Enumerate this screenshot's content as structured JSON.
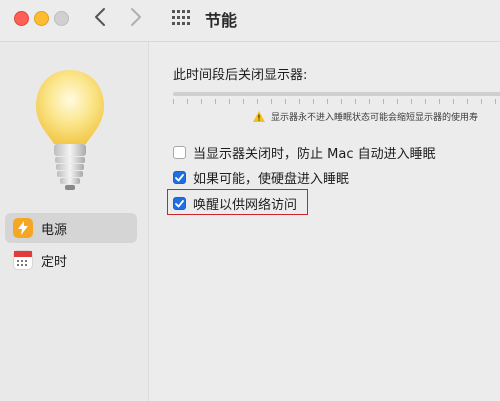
{
  "window": {
    "title": "节能",
    "nav": {
      "back_icon": "chevron-left-icon",
      "forward_icon": "chevron-right-icon",
      "grid_icon": "show-all-grid-icon"
    }
  },
  "sidebar": {
    "items": [
      {
        "label": "电源",
        "icon": "power-bolt-icon",
        "selected": true,
        "icon_color": "#f5a623"
      },
      {
        "label": "定时",
        "icon": "calendar-schedule-icon",
        "selected": false,
        "icon_color": "#e23b3b"
      }
    ]
  },
  "main": {
    "display_off_label": "此时间段后关闭显示器:",
    "warning_text": "显示器永不进入睡眠状态可能会缩短显示器的使用寿",
    "options": [
      {
        "label": "当显示器关闭时，防止 Mac 自动进入睡眠",
        "checked": false
      },
      {
        "label": "如果可能，使硬盘进入睡眠",
        "checked": true
      },
      {
        "label": "唤醒以供网络访问",
        "checked": true
      }
    ]
  },
  "colors": {
    "accent": "#1f6fe0",
    "highlight_border": "#c8262c"
  }
}
